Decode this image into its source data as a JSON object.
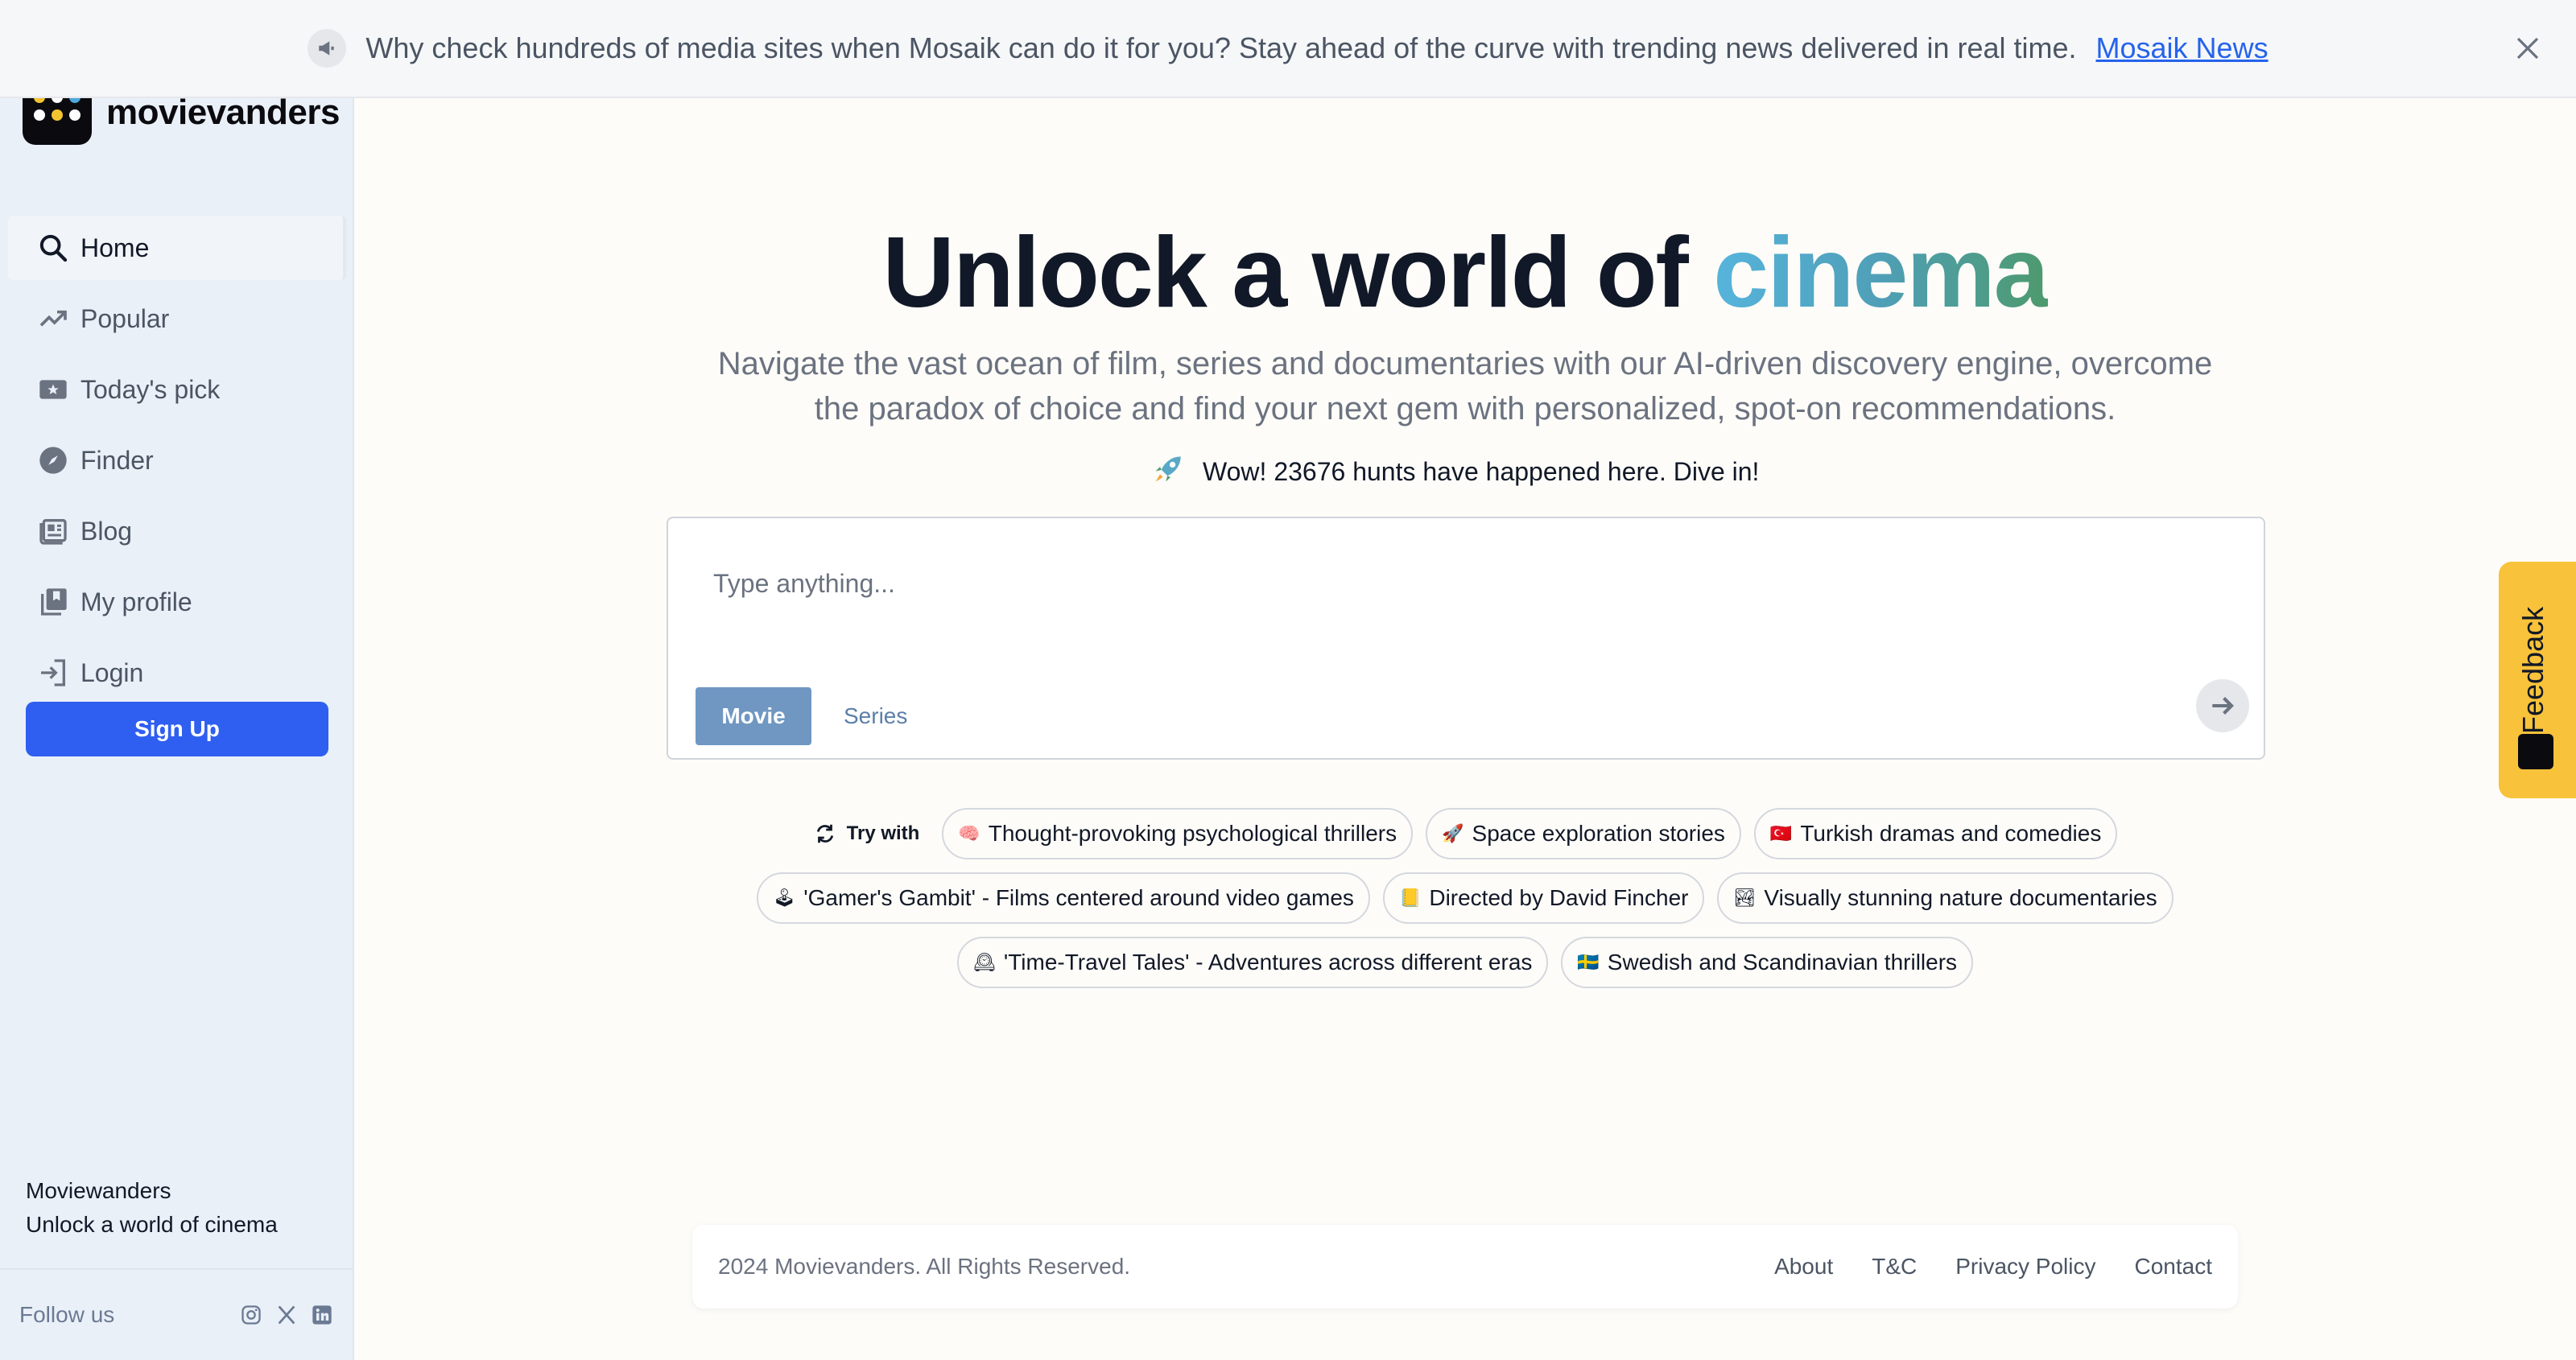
{
  "banner": {
    "text": "Why check hundreds of media sites when Mosaik can do it for you? Stay ahead of the curve with trending news delivered in real time.",
    "link": "Mosaik News"
  },
  "sidebar": {
    "brand": "movievanders",
    "items": [
      {
        "label": "Home",
        "icon": "search-icon"
      },
      {
        "label": "Popular",
        "icon": "trending-icon"
      },
      {
        "label": "Today's pick",
        "icon": "ticket-icon"
      },
      {
        "label": "Finder",
        "icon": "compass-icon"
      },
      {
        "label": "Blog",
        "icon": "newspaper-icon"
      },
      {
        "label": "My profile",
        "icon": "library-icon"
      },
      {
        "label": "Login",
        "icon": "login-icon"
      }
    ],
    "signup": "Sign Up",
    "footer_title": "Moviewanders",
    "footer_subtitle": "Unlock a world of cinema",
    "follow_label": "Follow us",
    "socials": [
      "instagram-icon",
      "x-icon",
      "linkedin-icon"
    ]
  },
  "hero": {
    "title_prefix": "Unlock a world of",
    "title_highlight": "cinema",
    "subtitle": "Navigate the vast ocean of film, series and documentaries with our AI-driven discovery engine, overcome the paradox of choice and find your next gem with personalized, spot-on recommendations.",
    "hunts": "Wow! 23676 hunts have happened here. Dive in!"
  },
  "search": {
    "placeholder": "Type anything...",
    "tab_movie": "Movie",
    "tab_series": "Series"
  },
  "suggestions": {
    "try_with": "Try with",
    "row1": [
      {
        "emoji": "🧠",
        "label": "Thought-provoking psychological thrillers"
      },
      {
        "emoji": "🚀",
        "label": "Space exploration stories"
      },
      {
        "emoji": "🇹🇷",
        "label": "Turkish dramas and comedies"
      }
    ],
    "row2": [
      {
        "emoji": "🕹",
        "label": "'Gamer's Gambit' - Films centered around video games"
      },
      {
        "emoji": "📒",
        "label": "Directed by David Fincher"
      },
      {
        "emoji": "🏞",
        "label": "Visually stunning nature documentaries"
      }
    ],
    "row3": [
      {
        "emoji": "🕰",
        "label": "'Time-Travel Tales' - Adventures across different eras"
      },
      {
        "emoji": "🇸🇪",
        "label": "Swedish and Scandinavian thrillers"
      }
    ]
  },
  "footer": {
    "copyright": "2024 Movievanders. All Rights Reserved.",
    "links": [
      "About",
      "T&C",
      "Privacy Policy",
      "Contact"
    ]
  },
  "feedback": {
    "label": "Feedback"
  },
  "colors": {
    "accent": "#2f5ff0",
    "movie_tab": "#6f97c2",
    "feedback": "#f8c23a",
    "sidebar_bg": "#eaf0f8"
  }
}
